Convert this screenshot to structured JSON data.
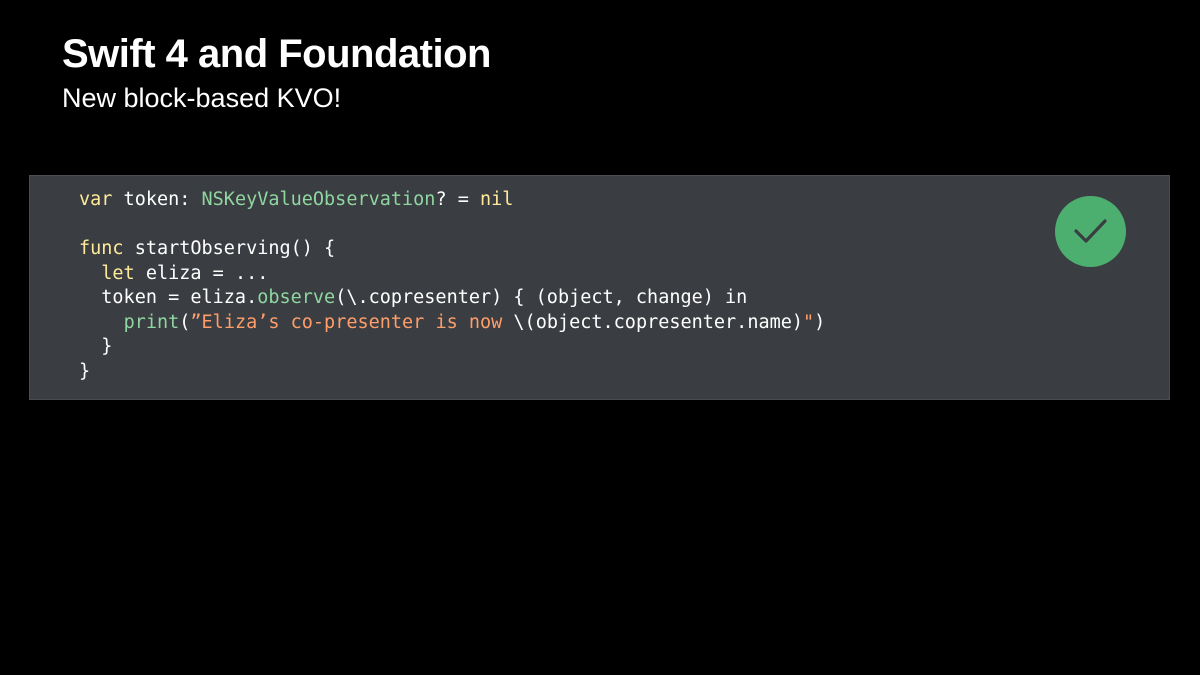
{
  "slide": {
    "title": "Swift 4 and Foundation",
    "subtitle": "New block-based KVO!"
  },
  "code": {
    "lines": [
      [
        {
          "text": "var",
          "kind": "keyword"
        },
        {
          "text": " token: ",
          "kind": "plain"
        },
        {
          "text": "NSKeyValueObservation",
          "kind": "type"
        },
        {
          "text": "? = ",
          "kind": "plain"
        },
        {
          "text": "nil",
          "kind": "keyword"
        }
      ],
      [],
      [
        {
          "text": "func",
          "kind": "keyword"
        },
        {
          "text": " startObserving() {",
          "kind": "plain"
        }
      ],
      [
        {
          "text": "  ",
          "kind": "plain"
        },
        {
          "text": "let",
          "kind": "keyword"
        },
        {
          "text": " eliza = ...",
          "kind": "plain"
        }
      ],
      [
        {
          "text": "  token = eliza.",
          "kind": "plain"
        },
        {
          "text": "observe",
          "kind": "method"
        },
        {
          "text": "(\\.copresenter) { (object, change) in",
          "kind": "plain"
        }
      ],
      [
        {
          "text": "    ",
          "kind": "plain"
        },
        {
          "text": "print",
          "kind": "method"
        },
        {
          "text": "(",
          "kind": "plain"
        },
        {
          "text": "”Eliza’s co-presenter is now ",
          "kind": "string"
        },
        {
          "text": "\\(object.copresenter.name)",
          "kind": "plain"
        },
        {
          "text": "\"",
          "kind": "string"
        },
        {
          "text": ")",
          "kind": "plain"
        }
      ],
      [
        {
          "text": "  }",
          "kind": "plain"
        }
      ],
      [
        {
          "text": "}",
          "kind": "plain"
        }
      ]
    ]
  },
  "badge": {
    "icon": "checkmark-icon",
    "color": "#4caf6f"
  },
  "colors": {
    "background": "#000000",
    "panel": "#3a3d41",
    "keyword": "#ffea9a",
    "type": "#8fd6a0",
    "string": "#ff9e6b"
  }
}
